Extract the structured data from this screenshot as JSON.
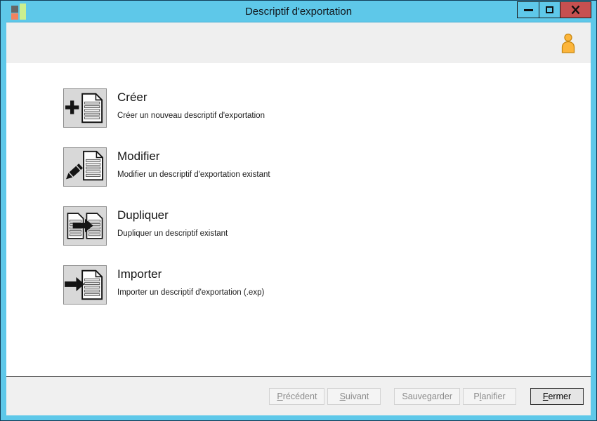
{
  "window": {
    "title": "Descriptif d'exportation",
    "controls": {
      "minimize": "minimize-icon",
      "maximize": "maximize-icon",
      "close": "close-icon"
    }
  },
  "header": {
    "user_icon": "user-icon"
  },
  "options": [
    {
      "title": "Créer",
      "description": "Créer un nouveau descriptif d'exportation",
      "icon": "plus-document-icon"
    },
    {
      "title": "Modifier",
      "description": "Modifier un descriptif d'exportation existant",
      "icon": "pencil-document-icon"
    },
    {
      "title": "Dupliquer",
      "description": "Dupliquer un descriptif existant",
      "icon": "duplicate-document-icon"
    },
    {
      "title": "Importer",
      "description": "Importer un descriptif d'exportation (.exp)",
      "icon": "arrow-into-document-icon"
    }
  ],
  "footer": {
    "buttons": [
      {
        "pre": "",
        "key": "P",
        "post": "récédent",
        "enabled": false
      },
      {
        "pre": "",
        "key": "S",
        "post": "uivant",
        "enabled": false
      },
      {
        "pre": "Sauvegarder",
        "key": "",
        "post": "",
        "enabled": false
      },
      {
        "pre": "P",
        "key": "l",
        "post": "anifier",
        "enabled": false
      },
      {
        "pre": "",
        "key": "F",
        "post": "ermer",
        "enabled": true
      }
    ]
  },
  "colors": {
    "titlebar_blue": "#5ec8e9",
    "border_navy": "#123c57",
    "close_button_red": "#c75050",
    "header_strip_gray": "#efefef",
    "footer_gray": "#f0f0f0",
    "icon_box_gray": "#d8d8d8",
    "user_icon_orange": "#fcb53b"
  }
}
